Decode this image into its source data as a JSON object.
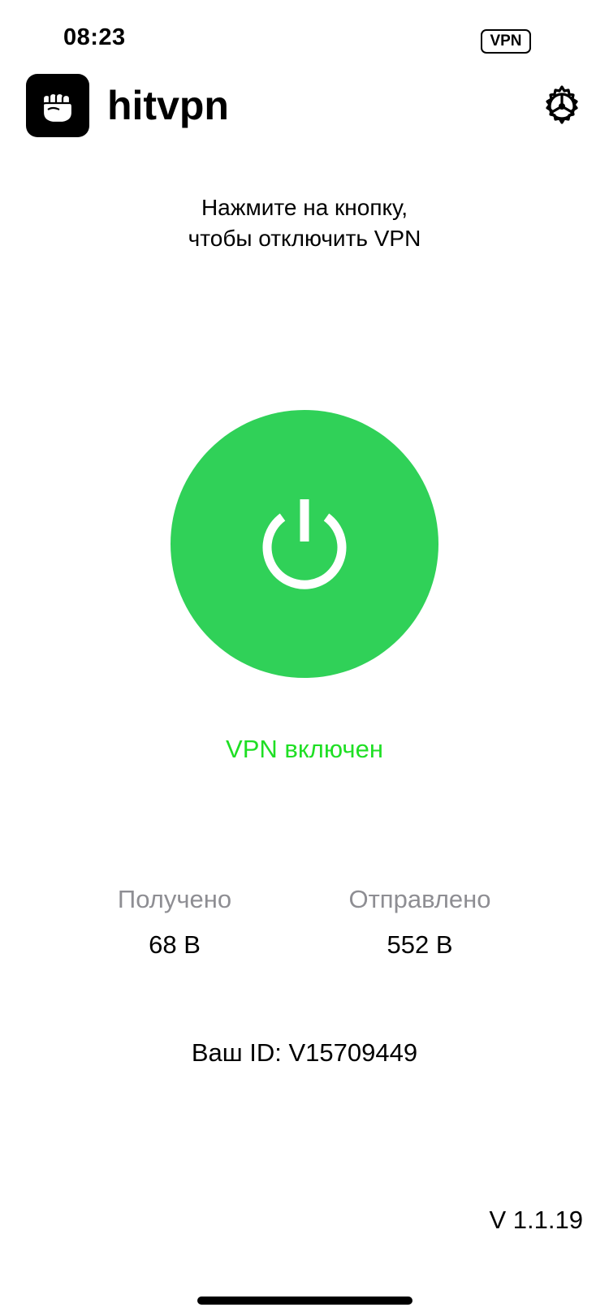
{
  "status_bar": {
    "time": "08:23",
    "vpn_badge": "VPN"
  },
  "header": {
    "app_name": "hitvpn",
    "logo_icon": "fist-icon",
    "settings_icon": "gear-icon"
  },
  "main": {
    "instruction_line1": "Нажмите на кнопку,",
    "instruction_line2": "чтобы отключить VPN",
    "power_icon": "power-icon",
    "status_text": "VPN включен",
    "button_color": "#30d158",
    "status_color": "#1fdf24"
  },
  "stats": {
    "received_label": "Получено",
    "received_value": "68 B",
    "sent_label": "Отправлено",
    "sent_value": "552 B"
  },
  "user": {
    "id_text": "Ваш ID: V15709449"
  },
  "footer": {
    "version": "V 1.1.19"
  }
}
